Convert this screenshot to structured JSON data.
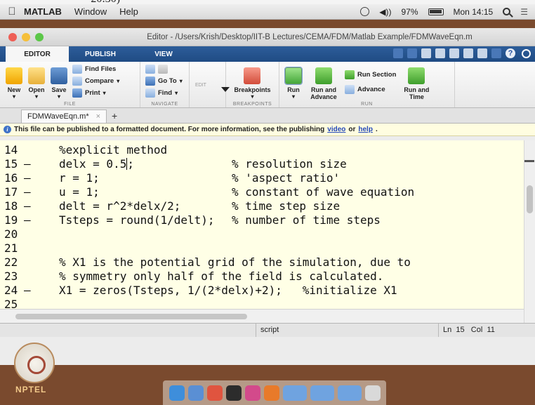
{
  "menubar": {
    "app": "MATLAB",
    "menus": [
      "Window",
      "Help"
    ],
    "battery": "97%",
    "clock": "Mon 14:15"
  },
  "window": {
    "title": "Editor - /Users/Krish/Desktop/IIT-B Lectures/CEMA/FDM/Matlab Example/FDMWaveEqn.m"
  },
  "toolstrip": {
    "tabs": [
      "EDITOR",
      "PUBLISH",
      "VIEW"
    ],
    "groups": {
      "file": "FILE",
      "navigate": "NAVIGATE",
      "edit": "EDIT",
      "breakpoints": "BREAKPOINTS",
      "run": "RUN"
    },
    "buttons": {
      "new": "New",
      "open": "Open",
      "save": "Save",
      "find_files": "Find Files",
      "compare": "Compare",
      "print": "Print",
      "go_to": "Go To",
      "find": "Find",
      "breakpoints": "Breakpoints",
      "run": "Run",
      "run_and_advance": "Run and Advance",
      "run_section": "Run Section",
      "advance": "Advance",
      "run_and_time": "Run and Time"
    }
  },
  "file_tab": {
    "name": "FDMWaveEqn.m*"
  },
  "banner": {
    "text": "This file can be published to a formatted document. For more information, see the publishing",
    "link1": "video",
    "or": "or",
    "link2": "help",
    "end": "."
  },
  "code_lines": [
    {
      "num": "14",
      "dash": "",
      "code": "%explicit method",
      "comment": ""
    },
    {
      "num": "15",
      "dash": "–",
      "code": "delx = 0.5",
      "comment": "% resolution size"
    },
    {
      "num": "16",
      "dash": "–",
      "code": "r = 1;",
      "comment": "% 'aspect ratio'"
    },
    {
      "num": "17",
      "dash": "–",
      "code": "u = 1;",
      "comment": "% constant of wave equation"
    },
    {
      "num": "18",
      "dash": "–",
      "code": "delt = r^2*delx/2;",
      "comment": "% time step size"
    },
    {
      "num": "19",
      "dash": "–",
      "code": "Tsteps = round(1/delt);",
      "comment": "% number of time steps"
    },
    {
      "num": "20",
      "dash": "",
      "code": "",
      "comment": ""
    },
    {
      "num": "21",
      "dash": "",
      "code": "",
      "comment": ""
    },
    {
      "num": "22",
      "dash": "",
      "code": "% X1 is the potential grid of the simulation, due to",
      "comment": ""
    },
    {
      "num": "23",
      "dash": "",
      "code": "% symmetry only half of the field is calculated.",
      "comment": ""
    },
    {
      "num": "24",
      "dash": "–",
      "code": "X1 = zeros(Tsteps, 1/(2*delx)+2);   %initialize X1",
      "comment": ""
    },
    {
      "num": "25",
      "dash": "",
      "code": "",
      "comment": ""
    }
  ],
  "cursor_suffix": ";",
  "status": {
    "mode": "script",
    "ln_label": "Ln",
    "ln": "15",
    "col_label": "Col",
    "col": "11"
  },
  "watermark": {
    "label": "NPTEL"
  }
}
